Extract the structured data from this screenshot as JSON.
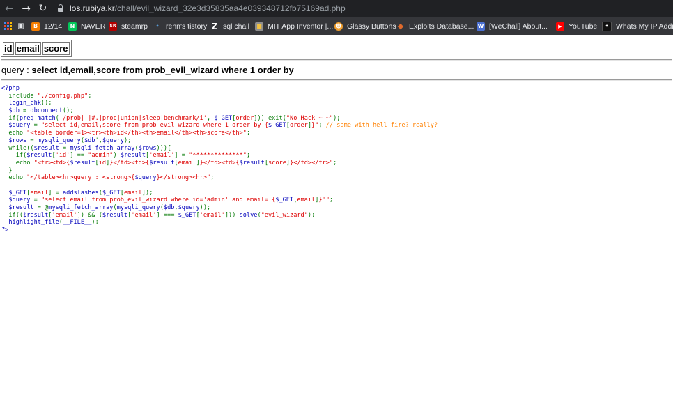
{
  "browser": {
    "url_host": "los.rubiya.kr",
    "url_path": "/chall/evil_wizard_32e3d35835aa4e039348712fb75169ad.php",
    "bookmarks": [
      {
        "label": "",
        "icon": "apps-grid-icon"
      },
      {
        "label": "",
        "icon": "bookmark-icon"
      },
      {
        "label": "12/14",
        "icon": "blogger-icon",
        "color": "#f57d00"
      },
      {
        "label": "NAVER",
        "icon": "naver-icon",
        "color": "#03c75a"
      },
      {
        "label": "steamrp",
        "icon": "steamrp-icon",
        "color": "#b40000"
      },
      {
        "label": "renn's tistory",
        "icon": "tistory-icon",
        "color": "#5a9bd5"
      },
      {
        "label": "sql chall",
        "icon": "z-icon",
        "color": "#ffffff"
      },
      {
        "label": "MIT App Inventor |...",
        "icon": "app-inventor-icon",
        "color": "#8e8e8e"
      },
      {
        "label": "Glassy Buttons",
        "icon": "glassy-icon",
        "color": "#f0a030"
      },
      {
        "label": "Exploits Database...",
        "icon": "exploit-db-icon",
        "color": "#e06a2c"
      },
      {
        "label": "[WeChall] About...",
        "icon": "wechall-icon",
        "color": "#4a6fd0"
      },
      {
        "label": "YouTube",
        "icon": "youtube-icon",
        "color": "#ff0000"
      },
      {
        "label": "Whats My IP Addr...",
        "icon": "whatsmyip-icon",
        "color": "#111111"
      }
    ]
  },
  "table": {
    "headers": [
      "id",
      "email",
      "score"
    ]
  },
  "query": {
    "label": "query : ",
    "value": "select id,email,score from prob_evil_wizard where 1 order by"
  },
  "source": [
    [
      [
        "d",
        "<?php"
      ]
    ],
    [
      [
        "d",
        "  "
      ],
      [
        "k",
        "include "
      ],
      [
        "s",
        "\"./config.php\""
      ],
      [
        "k",
        ";"
      ]
    ],
    [
      [
        "d",
        "  login_chk"
      ],
      [
        "k",
        "();"
      ]
    ],
    [
      [
        "d",
        "  $db "
      ],
      [
        "k",
        "= "
      ],
      [
        "d",
        "dbconnect"
      ],
      [
        "k",
        "();"
      ]
    ],
    [
      [
        "d",
        "  "
      ],
      [
        "k",
        "if("
      ],
      [
        "d",
        "preg_match"
      ],
      [
        "k",
        "("
      ],
      [
        "s",
        "'/prob|_|#.|proc|union|sleep|benchmark/i'"
      ],
      [
        "k",
        ", "
      ],
      [
        "d",
        "$_GET"
      ],
      [
        "k",
        "["
      ],
      [
        "s",
        "order"
      ],
      [
        "k",
        "])) exit("
      ],
      [
        "s",
        "\"No Hack ~_~\""
      ],
      [
        "k",
        ");"
      ]
    ],
    [
      [
        "d",
        "  $query "
      ],
      [
        "k",
        "= "
      ],
      [
        "s",
        "\"select id,email,score from prob_evil_wizard where 1 order by {"
      ],
      [
        "d",
        "$_GET"
      ],
      [
        "k",
        "["
      ],
      [
        "s",
        "order"
      ],
      [
        "k",
        "]"
      ],
      [
        "s",
        "}\""
      ],
      [
        "k",
        "; "
      ],
      [
        "c",
        "// same with hell_fire? really?"
      ]
    ],
    [
      [
        "d",
        "  "
      ],
      [
        "k",
        "echo "
      ],
      [
        "s",
        "\"<table border=1><tr><th>id</th><th>email</th><th>score</th>\""
      ],
      [
        "k",
        ";"
      ]
    ],
    [
      [
        "d",
        "  $rows "
      ],
      [
        "k",
        "= "
      ],
      [
        "d",
        "mysqli_query"
      ],
      [
        "k",
        "("
      ],
      [
        "d",
        "$db"
      ],
      [
        "k",
        "',"
      ],
      [
        "d",
        "$query"
      ],
      [
        "k",
        ");"
      ]
    ],
    [
      [
        "d",
        "  "
      ],
      [
        "k",
        "while(("
      ],
      [
        "d",
        "$result "
      ],
      [
        "k",
        "= "
      ],
      [
        "d",
        "mysqli_fetch_array"
      ],
      [
        "k",
        "("
      ],
      [
        "d",
        "$rows"
      ],
      [
        "k",
        "))){"
      ]
    ],
    [
      [
        "d",
        "    "
      ],
      [
        "k",
        "if("
      ],
      [
        "d",
        "$result"
      ],
      [
        "k",
        "["
      ],
      [
        "s",
        "'id'"
      ],
      [
        "k",
        "] == "
      ],
      [
        "s",
        "\"admin\""
      ],
      [
        "k",
        ") "
      ],
      [
        "d",
        "$result"
      ],
      [
        "k",
        "["
      ],
      [
        "s",
        "'email'"
      ],
      [
        "k",
        "] = "
      ],
      [
        "s",
        "\"**************\""
      ],
      [
        "k",
        ";"
      ]
    ],
    [
      [
        "d",
        "    "
      ],
      [
        "k",
        "echo "
      ],
      [
        "s",
        "\"<tr><td>{"
      ],
      [
        "d",
        "$result"
      ],
      [
        "k",
        "["
      ],
      [
        "s",
        "id"
      ],
      [
        "k",
        "]"
      ],
      [
        "s",
        "}</td><td>{"
      ],
      [
        "d",
        "$result"
      ],
      [
        "k",
        "["
      ],
      [
        "s",
        "email"
      ],
      [
        "k",
        "]"
      ],
      [
        "s",
        "}</td><td>{"
      ],
      [
        "d",
        "$result"
      ],
      [
        "k",
        "["
      ],
      [
        "s",
        "score"
      ],
      [
        "k",
        "]"
      ],
      [
        "s",
        "}</td></tr>\""
      ],
      [
        "k",
        ";"
      ]
    ],
    [
      [
        "d",
        "  "
      ],
      [
        "k",
        "}"
      ]
    ],
    [
      [
        "d",
        "  "
      ],
      [
        "k",
        "echo "
      ],
      [
        "s",
        "\"</table><hr>query : <strong>{"
      ],
      [
        "d",
        "$query"
      ],
      [
        "s",
        "}</strong><hr>\""
      ],
      [
        "k",
        ";"
      ]
    ],
    [
      [
        "d",
        ""
      ]
    ],
    [
      [
        "d",
        "  $_GET"
      ],
      [
        "k",
        "["
      ],
      [
        "s",
        "email"
      ],
      [
        "k",
        "] = "
      ],
      [
        "d",
        "addslashes"
      ],
      [
        "k",
        "("
      ],
      [
        "d",
        "$_GET"
      ],
      [
        "k",
        "["
      ],
      [
        "s",
        "email"
      ],
      [
        "k",
        "]);"
      ]
    ],
    [
      [
        "d",
        "  $query "
      ],
      [
        "k",
        "= "
      ],
      [
        "s",
        "\"select email from prob_evil_wizard where id='admin' and email='{"
      ],
      [
        "d",
        "$_GET"
      ],
      [
        "k",
        "["
      ],
      [
        "s",
        "email"
      ],
      [
        "k",
        "]"
      ],
      [
        "s",
        "}'\""
      ],
      [
        "k",
        ";"
      ]
    ],
    [
      [
        "d",
        "  $result "
      ],
      [
        "k",
        "= @"
      ],
      [
        "d",
        "mysqli_fetch_array"
      ],
      [
        "k",
        "("
      ],
      [
        "d",
        "mysqli_query"
      ],
      [
        "k",
        "("
      ],
      [
        "d",
        "$db"
      ],
      [
        "k",
        ","
      ],
      [
        "d",
        "$query"
      ],
      [
        "k",
        "));"
      ]
    ],
    [
      [
        "d",
        "  "
      ],
      [
        "k",
        "if(("
      ],
      [
        "d",
        "$result"
      ],
      [
        "k",
        "["
      ],
      [
        "s",
        "'email'"
      ],
      [
        "k",
        "]) && ("
      ],
      [
        "d",
        "$result"
      ],
      [
        "k",
        "["
      ],
      [
        "s",
        "'email'"
      ],
      [
        "k",
        "] === "
      ],
      [
        "d",
        "$_GET"
      ],
      [
        "k",
        "["
      ],
      [
        "s",
        "'email'"
      ],
      [
        "k",
        "])) "
      ],
      [
        "d",
        "solve"
      ],
      [
        "k",
        "("
      ],
      [
        "s",
        "\"evil_wizard\""
      ],
      [
        "k",
        ");"
      ]
    ],
    [
      [
        "d",
        "  highlight_file"
      ],
      [
        "k",
        "("
      ],
      [
        "d",
        "__FILE__"
      ],
      [
        "k",
        ");"
      ]
    ],
    [
      [
        "d",
        "?>"
      ]
    ]
  ]
}
